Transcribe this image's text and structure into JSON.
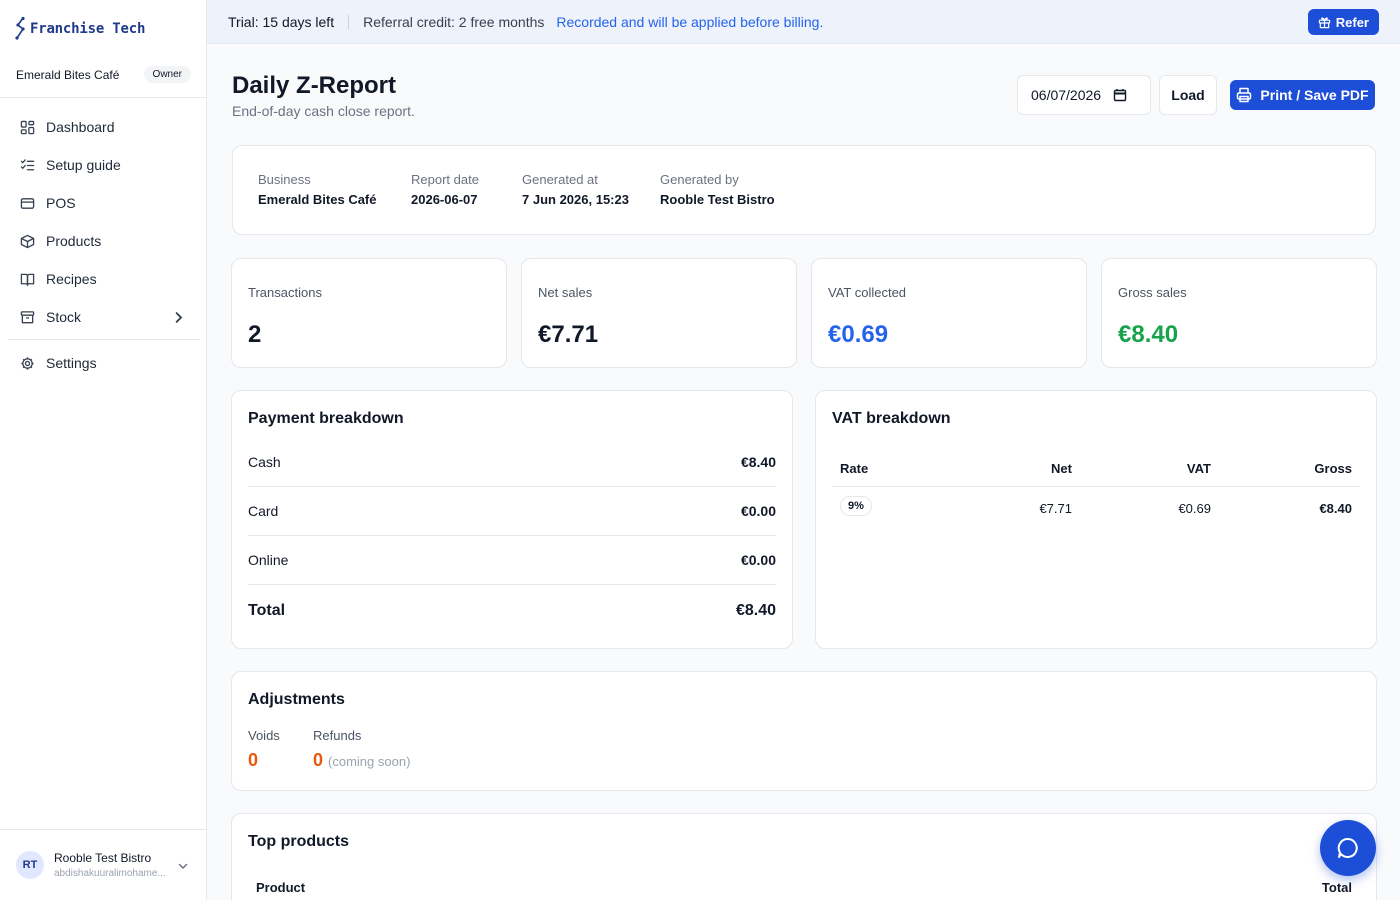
{
  "brand": {
    "name": "Franchise Tech",
    "color": "#1e3a8a"
  },
  "sidebar": {
    "business_name": "Emerald Bites Café",
    "role": "Owner",
    "items": [
      {
        "label": "Dashboard",
        "icon": "dashboard-icon"
      },
      {
        "label": "Setup guide",
        "icon": "checklist-icon"
      },
      {
        "label": "POS",
        "icon": "card-icon"
      },
      {
        "label": "Products",
        "icon": "box-icon"
      },
      {
        "label": "Recipes",
        "icon": "book-icon"
      },
      {
        "label": "Stock",
        "icon": "archive-icon"
      },
      {
        "label": "Settings",
        "icon": "gear-icon"
      }
    ],
    "user": {
      "initials": "RT",
      "name": "Rooble Test Bistro",
      "email": "abdishakuuralimohame..."
    }
  },
  "banner": {
    "trial": "Trial: 15 days left",
    "credit": "Referral credit: 2 free months",
    "recorded": "Recorded and will be applied before billing.",
    "refer_label": "Refer"
  },
  "header": {
    "title": "Daily Z-Report",
    "subtitle": "End-of-day cash close report.",
    "date_value": "06/07/2026",
    "load_label": "Load",
    "print_label": "Print / Save PDF"
  },
  "meta": {
    "business_label": "Business",
    "business_value": "Emerald Bites Café",
    "date_label": "Report date",
    "date_value": "2026-06-07",
    "generated_at_label": "Generated at",
    "generated_at_value": "7 Jun 2026, 15:23",
    "generated_by_label": "Generated by",
    "generated_by_value": "Rooble Test Bistro"
  },
  "stats": [
    {
      "label": "Transactions",
      "value": "2",
      "color": "#111827"
    },
    {
      "label": "Net sales",
      "value": "€7.71",
      "color": "#111827"
    },
    {
      "label": "VAT collected",
      "value": "€0.69",
      "color": "#2563eb"
    },
    {
      "label": "Gross sales",
      "value": "€8.40",
      "color": "#16a34a"
    }
  ],
  "payment": {
    "title": "Payment breakdown",
    "rows": [
      {
        "label": "Cash",
        "amount": "€8.40"
      },
      {
        "label": "Card",
        "amount": "€0.00"
      },
      {
        "label": "Online",
        "amount": "€0.00"
      }
    ],
    "total_label": "Total",
    "total_amount": "€8.40"
  },
  "vat": {
    "title": "VAT breakdown",
    "headers": {
      "rate": "Rate",
      "net": "Net",
      "vat": "VAT",
      "gross": "Gross"
    },
    "rows": [
      {
        "rate": "9%",
        "net": "€7.71",
        "vat": "€0.69",
        "gross": "€8.40"
      }
    ]
  },
  "adjustments": {
    "title": "Adjustments",
    "voids_label": "Voids",
    "voids_value": "0",
    "refunds_label": "Refunds",
    "refunds_value": "0",
    "refunds_note": "(coming soon)"
  },
  "top_products": {
    "title": "Top products",
    "col_product": "Product",
    "col_total": "Total"
  }
}
